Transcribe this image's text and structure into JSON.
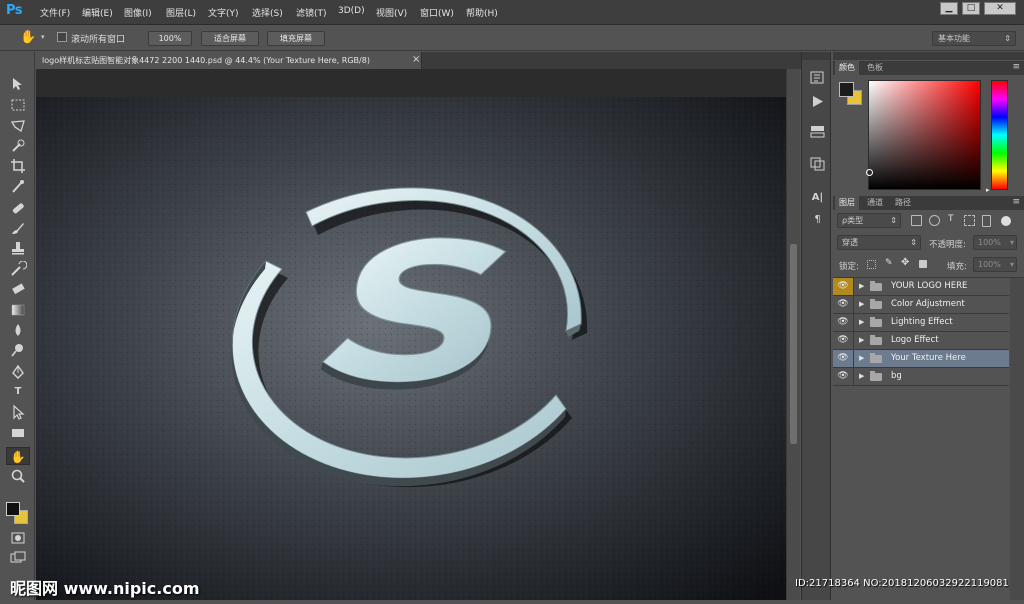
{
  "app": {
    "logo": "Ps",
    "menu": [
      "文件(F)",
      "编辑(E)",
      "图像(I)",
      "图层(L)",
      "文字(Y)",
      "选择(S)",
      "滤镜(T)",
      "3D(D)",
      "视图(V)",
      "窗口(W)",
      "帮助(H)"
    ],
    "window_buttons": {
      "minimize": "▁",
      "maximize": "□",
      "close": "✕"
    }
  },
  "options_bar": {
    "scroll_all_label": "滚动所有窗口",
    "zoom_100": "100%",
    "fit_screen": "适合屏幕",
    "fill_screen": "填充屏幕",
    "workspace": "基本功能"
  },
  "document": {
    "tab_title": "logo样机标志贴图智能对象4472 2200 1440.psd @ 44.4% (Your Texture Here, RGB/8)",
    "tab_close": "×"
  },
  "color_panel": {
    "tabs": [
      "颜色",
      "色板"
    ],
    "fg_color": "#1c1c1c",
    "bg_color": "#e5c33a"
  },
  "layers_panel": {
    "tabs": [
      "图层",
      "通道",
      "路径"
    ],
    "filter_label": "ρ类型",
    "blend_mode": "穿透",
    "opacity_label": "不透明度:",
    "opacity_value": "100%",
    "lock_label": "锁定:",
    "fill_label": "填充:",
    "fill_value": "100%",
    "layers": [
      {
        "name": "YOUR LOGO HERE",
        "visible": true,
        "selected": false
      },
      {
        "name": "Color Adjustment",
        "visible": true,
        "selected": false
      },
      {
        "name": "Lighting Effect",
        "visible": true,
        "selected": false
      },
      {
        "name": "Logo Effect",
        "visible": true,
        "selected": false
      },
      {
        "name": "Your Texture Here",
        "visible": true,
        "selected": true
      },
      {
        "name": "bg",
        "visible": true,
        "selected": false
      }
    ]
  },
  "overlay": {
    "watermark": "昵图网 www.nipic.com",
    "image_id": "ID:21718364 NO:20181206032922119081"
  },
  "colors": {
    "ps_blue": "#2fa8f5",
    "panel": "#535353",
    "menubar": "#3e3e3e",
    "selected_layer": "#6d7b8f",
    "logo_metal": "#cfe3e8"
  }
}
